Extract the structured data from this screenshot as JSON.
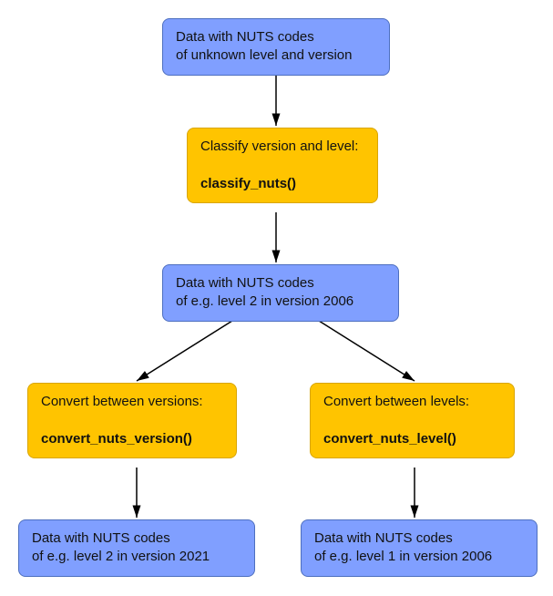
{
  "nodes": {
    "input": {
      "line1": "Data with NUTS codes",
      "line2": "of unknown level and version"
    },
    "classify": {
      "label": "Classify version and level:",
      "fn": "classify_nuts()"
    },
    "classified": {
      "line1": "Data with NUTS codes",
      "line2": "of e.g. level 2 in version 2006"
    },
    "convert_version": {
      "label": "Convert between versions:",
      "fn": "convert_nuts_version()"
    },
    "convert_level": {
      "label": "Convert between levels:",
      "fn": "convert_nuts_level()"
    },
    "out_version": {
      "line1": "Data with NUTS codes",
      "line2": "of e.g. level 2 in version 2021"
    },
    "out_level": {
      "line1": "Data with NUTS codes",
      "line2": "of e.g. level 1 in version 2006"
    }
  }
}
